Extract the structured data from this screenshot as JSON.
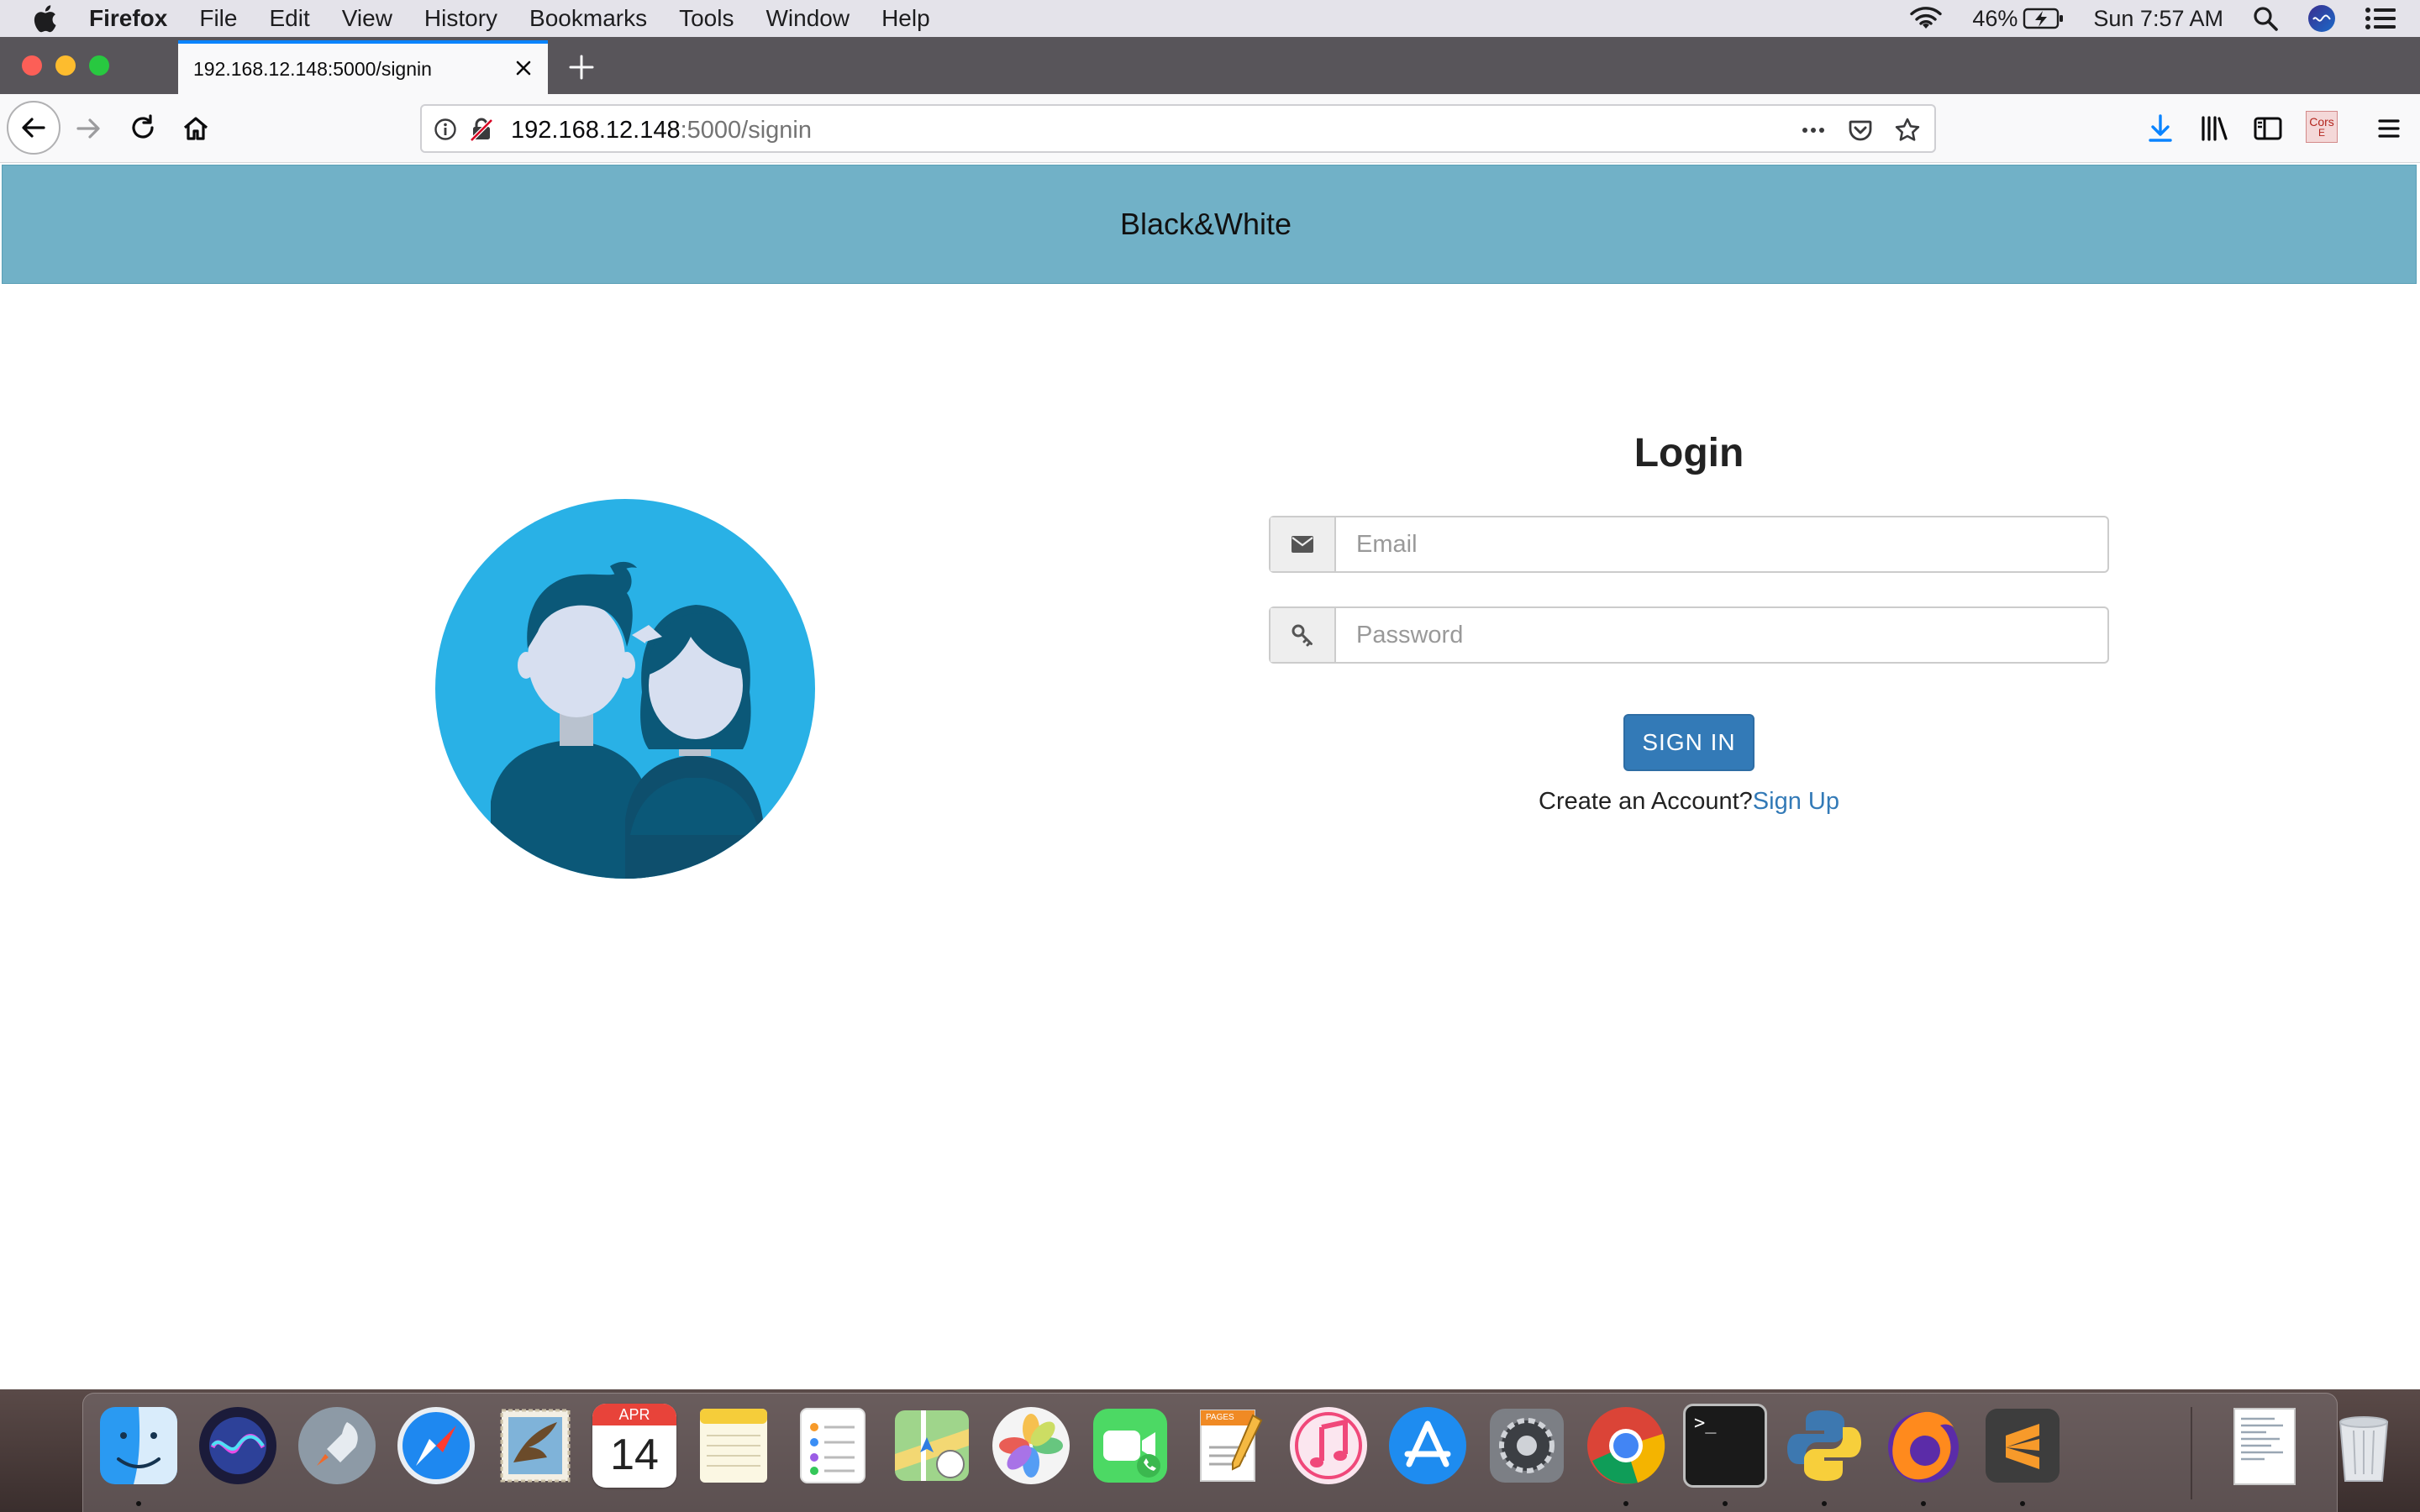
{
  "menubar": {
    "app_name": "Firefox",
    "items": [
      "File",
      "Edit",
      "View",
      "History",
      "Bookmarks",
      "Tools",
      "Window",
      "Help"
    ],
    "battery_percent": "46%",
    "clock": "Sun 7:57 AM"
  },
  "browser": {
    "tab_title": "192.168.12.148:5000/signin",
    "url_host": "192.168.12.148",
    "url_path": ":5000/signin",
    "extension_label_1": "Cors",
    "extension_label_2": "E"
  },
  "page": {
    "site_title": "Black&White",
    "login_title": "Login",
    "email_placeholder": "Email",
    "password_placeholder": "Password",
    "signin_label": "SIGN IN",
    "create_account_text": "Create an Account?",
    "signup_link": "Sign Up"
  },
  "dock": {
    "calendar_month": "APR",
    "calendar_day": "14",
    "pages_label": "PAGES",
    "terminal_prompt": ">_"
  },
  "colors": {
    "header_bg": "#71b1c7",
    "primary": "#337ab7",
    "avatar_bg": "#29b1e6",
    "avatar_dark": "#0b5878"
  }
}
